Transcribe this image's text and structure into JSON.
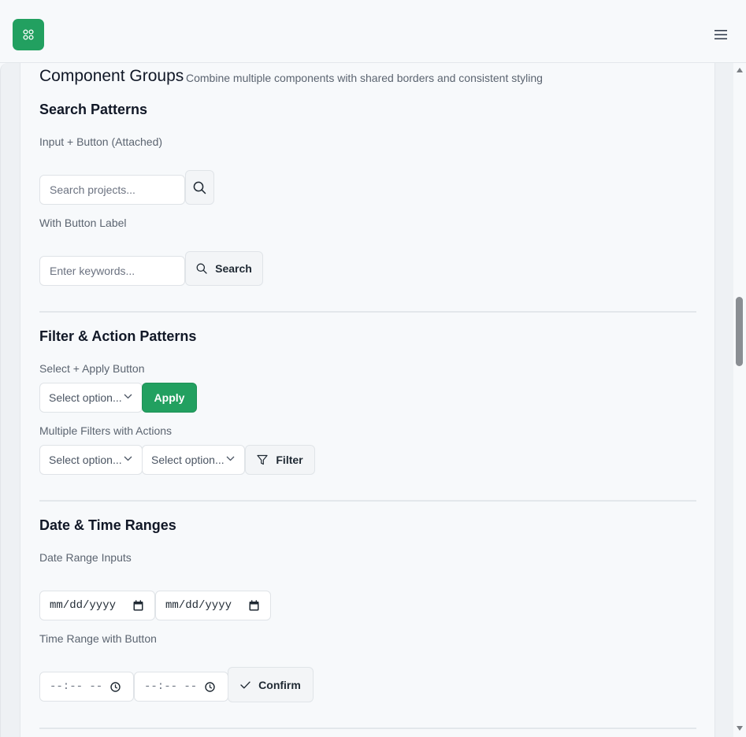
{
  "header": {
    "logo_icon": "grid-icon",
    "menu_icon": "hamburger-menu-icon",
    "accent_color": "#22a060"
  },
  "page": {
    "title": "Component Groups",
    "subtitle": "Combine multiple components with shared borders and consistent styling"
  },
  "search_patterns": {
    "heading": "Search Patterns",
    "attached": {
      "label": "Input + Button (Attached)",
      "placeholder": "Search projects...",
      "button_icon": "search-icon"
    },
    "labeled": {
      "label": "With Button Label",
      "placeholder": "Enter keywords...",
      "button_label": "Search",
      "button_icon": "search-icon"
    }
  },
  "filter_patterns": {
    "heading": "Filter & Action Patterns",
    "select_apply": {
      "label": "Select + Apply Button",
      "select_value": "Select option...",
      "button_label": "Apply"
    },
    "multi_filter": {
      "label": "Multiple Filters with Actions",
      "select1_value": "Select option...",
      "select2_value": "Select option...",
      "button_label": "Filter",
      "button_icon": "filter-icon"
    }
  },
  "date_time": {
    "heading": "Date & Time Ranges",
    "date_range": {
      "label": "Date Range Inputs",
      "start_value": "mm/dd/yyyy",
      "end_value": "mm/dd/yyyy"
    },
    "time_range": {
      "label": "Time Range with Button",
      "start_value": "--:-- --",
      "end_value": "--:-- --",
      "button_label": "Confirm",
      "button_icon": "check-icon"
    }
  }
}
